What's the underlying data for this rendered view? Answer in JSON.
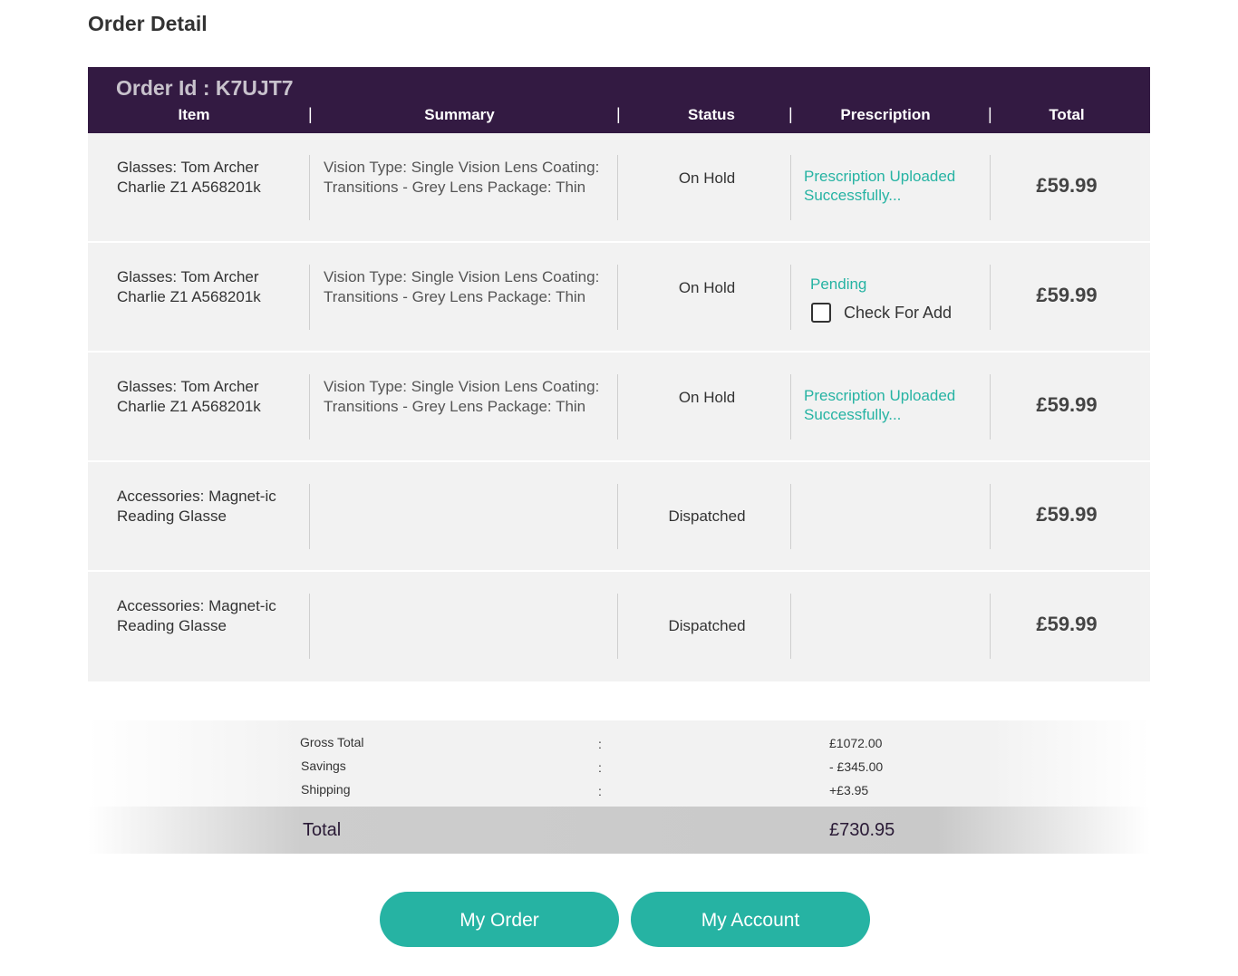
{
  "page_title": "Order Detail",
  "order": {
    "id_label": "Order Id : K7UJT7",
    "columns": [
      "Item",
      "Summary",
      "Status",
      "Prescription",
      "Total"
    ]
  },
  "rows": [
    {
      "item": "Glasses: Tom Archer Charlie Z1 A568201k",
      "summary": "Vision Type: Single Vision Lens Coating: Transitions - Grey Lens Package: Thin",
      "status": "On Hold",
      "prescription": "Prescription Uploaded Successfully...",
      "total": "£59.99"
    },
    {
      "item": "Glasses: Tom Archer Charlie Z1 A568201k",
      "summary": "Vision Type: Single Vision Lens Coating: Transitions - Grey Lens Package: Thin",
      "status": "On Hold",
      "prescription_pending": "Pending",
      "checkbox_label": "Check For Add",
      "total": "£59.99"
    },
    {
      "item": "Glasses: Tom Archer Charlie Z1 A568201k",
      "summary": "Vision Type: Single Vision Lens Coating: Transitions - Grey Lens Package: Thin",
      "status": "On Hold",
      "prescription": "Prescription Uploaded Successfully...",
      "total": "£59.99"
    },
    {
      "item": "Accessories: Magnet-ic Reading Glasse",
      "summary": "",
      "status": "Dispatched",
      "prescription": "",
      "total": "£59.99"
    },
    {
      "item": "Accessories: Magnet-ic Reading Glasse",
      "summary": "",
      "status": "Dispatched",
      "prescription": "",
      "total": "£59.99"
    }
  ],
  "totals": {
    "gross_label": "Gross Total",
    "gross_value": "£1072.00",
    "savings_label": "Savings",
    "savings_value": "- £345.00",
    "shipping_label": "Shipping",
    "shipping_value": "+£3.95",
    "separator": ":",
    "total_label": "Total",
    "total_value": "£730.95"
  },
  "buttons": {
    "my_order": "My Order",
    "my_account": "My Account"
  },
  "colors": {
    "header_bg": "#331a42",
    "accent": "#26b3a3",
    "row_bg": "#f2f2f2"
  }
}
